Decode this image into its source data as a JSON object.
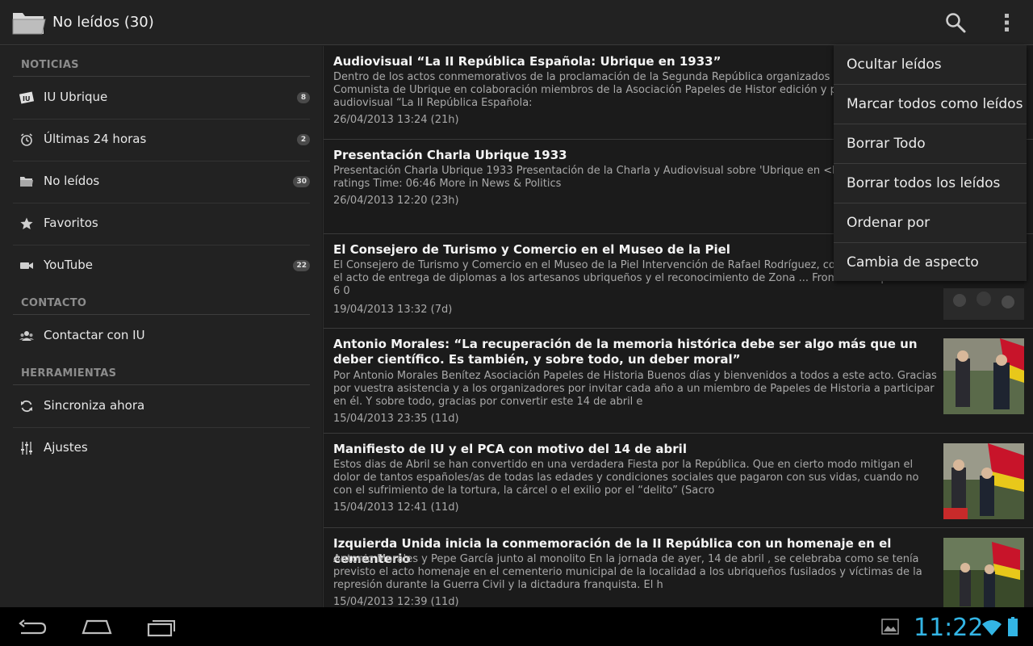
{
  "actionbar": {
    "title": "No leídos (30)",
    "icons": [
      "folder-icon",
      "search-icon",
      "overflow-menu-icon"
    ]
  },
  "sidebar": {
    "sections": [
      {
        "header": "NOTICIAS",
        "items": [
          {
            "label": "IU Ubrique",
            "count": "8",
            "icon": "iu-logo-icon"
          },
          {
            "label": "Últimas 24 horas",
            "count": "2",
            "icon": "alarm-clock-icon"
          },
          {
            "label": "No leídos",
            "count": "30",
            "icon": "folder-icon"
          },
          {
            "label": "Favoritos",
            "count": null,
            "icon": "star-icon"
          },
          {
            "label": "YouTube",
            "count": "22",
            "icon": "video-camera-icon"
          }
        ]
      },
      {
        "header": "CONTACTO",
        "items": [
          {
            "label": "Contactar con IU",
            "icon": "people-icon"
          }
        ]
      },
      {
        "header": "HERRAMIENTAS",
        "items": [
          {
            "label": "Sincroniza ahora",
            "icon": "sync-icon"
          },
          {
            "label": "Ajustes",
            "icon": "sliders-icon"
          }
        ]
      }
    ]
  },
  "articles": [
    {
      "title": "Audiovisual “La II República Española: Ubrique en 1933”",
      "description": "Dentro de los actos conmemorativos de la proclamación de la Segunda República organizados por l CA y el Partido Comunista de Ubrique en colaboración miembros de la Asociación Papeles de Histor edición y proyección del audiovisual “La II República Española:",
      "date": "26/04/2013 13:24 (21h)"
    },
    {
      "title": "Presentación Charla Ubrique 1933",
      "description": "Presentación Charla Ubrique 1933 Presentación de la Charla y Audiovisual sobre 'Ubrique en <b>...< Views: 1 0 ratings Time: 06:46 More in News & Politics",
      "date": "26/04/2013 12:20 (23h)"
    },
    {
      "title": "El Consejero de Turismo y Comercio en el Museo de la Piel",
      "description": "El Consejero de Turismo y Comercio en el Museo de la Piel Intervención de Rafael Rodríguez, conseje Comercio, en el acto de entrega de diplomas a los artesanos ubriqueños y el reconocimiento de Zona ... From IU Ubrique Views: 6 0",
      "date": "19/04/2013 13:32 (7d)"
    },
    {
      "title": "Antonio Morales: “La recuperación de la memoria histórica debe ser algo más que un deber científico. Es también, y sobre todo, un deber moral”",
      "description": "Por Antonio Morales Benítez Asociación Papeles de Historia Buenos días y bienvenidos a todos a este acto. Gracias por vuestra asistencia y a los organizadores por invitar cada año a un miembro de Papeles de Historia a participar en él. Y sobre todo, gracias por convertir este 14 de abril e",
      "date": "15/04/2013 23:35 (11d)"
    },
    {
      "title": "Manifiesto de IU y el PCA con motivo del 14 de abril",
      "description": "Estos dias de Abril se han convertido en una verdadera Fiesta por la República. Que en cierto modo mitigan el dolor de tantos españoles/as de todas las edades y condiciones sociales que pagaron con sus vidas, cuando no con el sufrimiento de la tortura, la cárcel o el exilio por el “delito” (Sacro",
      "date": "15/04/2013 12:41 (11d)"
    },
    {
      "title": "Izquierda Unida inicia la conmemoración de la II República con un homenaje en el cementerio",
      "description": "Antonio Morales y Pepe García junto al monolito En la jornada de ayer, 14 de abril , se celebraba como se tenía previsto el acto homenaje en el cementerio municipal de la localidad a los ubriqueños fusilados y víctimas de la represión durante la Guerra Civil y la dictadura franquista. El h",
      "date": "15/04/2013 12:39 (11d)"
    }
  ],
  "overflow_menu": {
    "items": [
      "Ocultar leídos",
      "Marcar todos como leídos",
      "Borrar Todo",
      "Borrar todos los leídos",
      "Ordenar por",
      "Cambia de aspecto"
    ]
  },
  "navbar": {
    "clock": "11:22",
    "icons": [
      "back-icon",
      "home-icon",
      "recent-apps-icon",
      "gallery-notification-icon",
      "wifi-icon",
      "battery-icon"
    ]
  },
  "colors": {
    "accent": "#33b5e5",
    "background": "#1b1b1b",
    "panel": "#222222"
  }
}
